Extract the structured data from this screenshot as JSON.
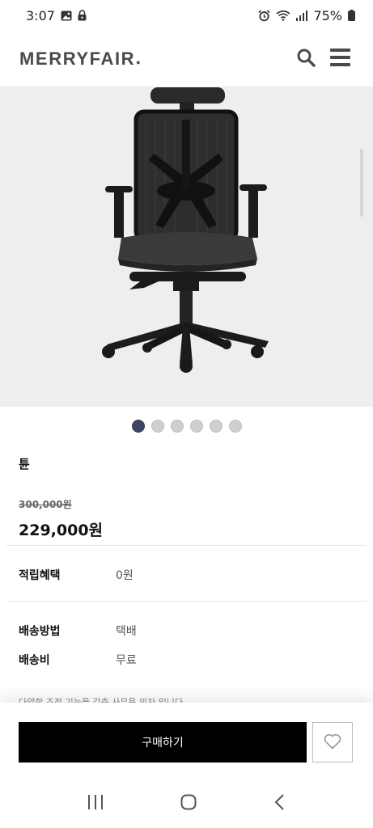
{
  "status_bar": {
    "time": "3:07",
    "battery": "75%",
    "left_icons": [
      "gallery-icon",
      "lock-icon"
    ],
    "right_icons": [
      "alarm-icon",
      "wifi-icon",
      "signal-icon",
      "battery-icon"
    ]
  },
  "header": {
    "brand": "MERRYFAIR",
    "brand_mark": "●",
    "icons": [
      "search-icon",
      "menu-icon"
    ]
  },
  "gallery": {
    "image_count": 6,
    "active_index": 0,
    "subject": "black mesh office chair"
  },
  "product": {
    "name": "튠",
    "original_price": "300,000원",
    "sale_price": "229,000원"
  },
  "info": {
    "points_label": "적립혜택",
    "points_value": "0원",
    "shipping_method_label": "배송방법",
    "shipping_method_value": "택배",
    "shipping_fee_label": "배송비",
    "shipping_fee_value": "무료"
  },
  "description_partial": "다양한 조정 기능을 갖춘 사무용 의자 입니다.",
  "actions": {
    "buy_label": "구매하기",
    "wishlist_icon": "heart-icon"
  },
  "system_nav": [
    "recent-apps-icon",
    "home-icon",
    "back-icon"
  ],
  "colors": {
    "buy_button": "#000000",
    "active_dot": "#3c4660",
    "logo": "#4a4a4a"
  }
}
